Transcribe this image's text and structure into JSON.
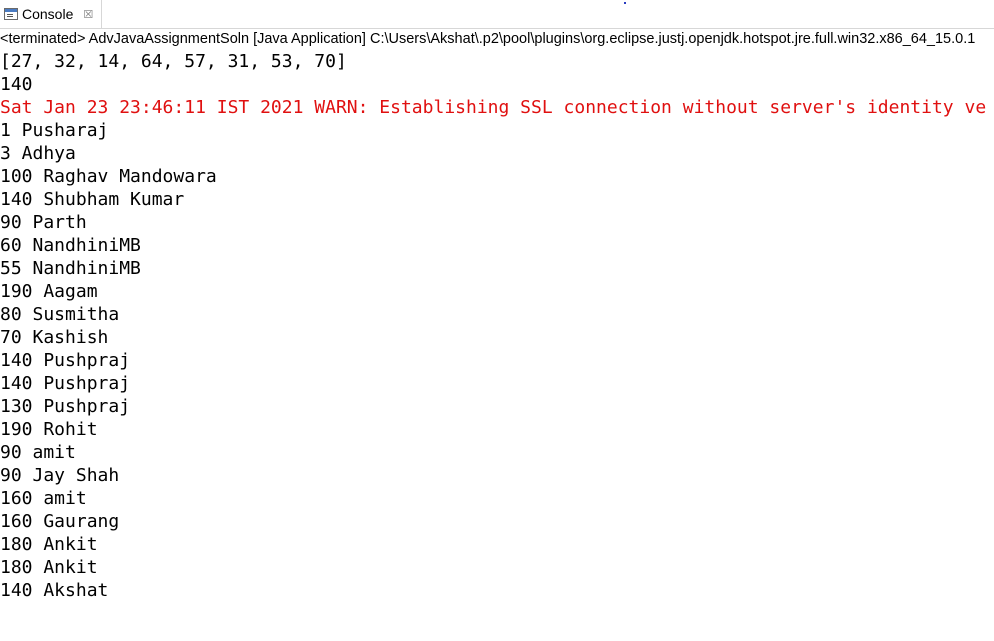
{
  "tab": {
    "label": "Console",
    "close_icon": "close-icon",
    "console_icon": "console-icon"
  },
  "status": "<terminated> AdvJavaAssignmentSoln [Java Application] C:\\Users\\Akshat\\.p2\\pool\\plugins\\org.eclipse.justj.openjdk.hotspot.jre.full.win32.x86_64_15.0.1",
  "colors": {
    "stderr": "#e01010",
    "stdout": "#000000"
  },
  "output": [
    {
      "text": "[27, 32, 14, 64, 57, 31, 53, 70]",
      "stream": "out"
    },
    {
      "text": "140",
      "stream": "out"
    },
    {
      "text": "Sat Jan 23 23:46:11 IST 2021 WARN: Establishing SSL connection without server's identity ve",
      "stream": "err"
    },
    {
      "text": "1 Pusharaj",
      "stream": "out"
    },
    {
      "text": "3 Adhya",
      "stream": "out"
    },
    {
      "text": "100 Raghav Mandowara",
      "stream": "out"
    },
    {
      "text": "140 Shubham Kumar",
      "stream": "out"
    },
    {
      "text": "90 Parth",
      "stream": "out"
    },
    {
      "text": "60 NandhiniMB",
      "stream": "out"
    },
    {
      "text": "55 NandhiniMB",
      "stream": "out"
    },
    {
      "text": "190 Aagam",
      "stream": "out"
    },
    {
      "text": "80 Susmitha",
      "stream": "out"
    },
    {
      "text": "70 Kashish",
      "stream": "out"
    },
    {
      "text": "140 Pushpraj",
      "stream": "out"
    },
    {
      "text": "140 Pushpraj",
      "stream": "out"
    },
    {
      "text": "130 Pushpraj",
      "stream": "out"
    },
    {
      "text": "190 Rohit",
      "stream": "out"
    },
    {
      "text": "90 amit",
      "stream": "out"
    },
    {
      "text": "90 Jay Shah",
      "stream": "out"
    },
    {
      "text": "160 amit",
      "stream": "out"
    },
    {
      "text": "160 Gaurang",
      "stream": "out"
    },
    {
      "text": "180 Ankit",
      "stream": "out"
    },
    {
      "text": "180 Ankit",
      "stream": "out"
    },
    {
      "text": "140 Akshat",
      "stream": "out"
    }
  ]
}
